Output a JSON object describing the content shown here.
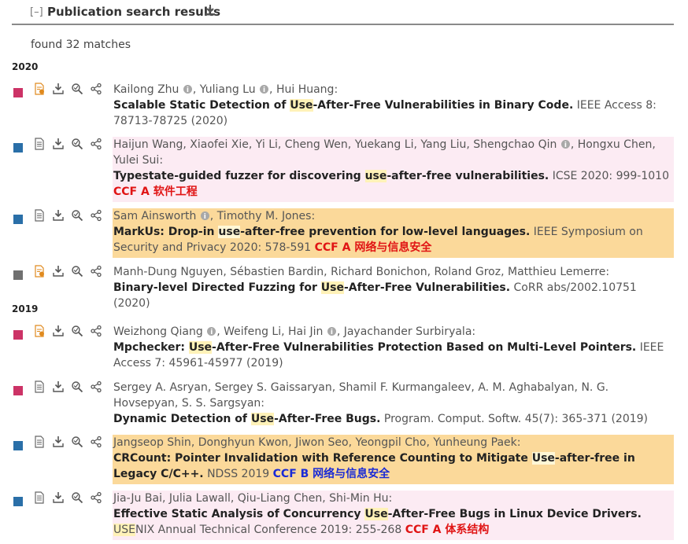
{
  "header": {
    "collapse_label": "[–]",
    "title": "Publication search results"
  },
  "results": {
    "count_text": "found 32 matches"
  },
  "colors": {
    "journal": "#cc3366",
    "conference": "#2a6fa8",
    "informal": "#707070",
    "ccf_a": "#e01414",
    "ccf_b": "#1a2bd6",
    "pink_bg": "#fcebf3",
    "orange_bg": "#fbd99a"
  },
  "years": [
    {
      "year": "2020",
      "entries": [
        {
          "type": "journal",
          "authors": [
            "Kailong Zhu",
            "Yuliang Lu",
            "Hui Huang"
          ],
          "orcid": [
            true,
            true,
            false
          ],
          "title_pre": "Scalable Static Detection of ",
          "title_hl": "Use",
          "title_post": "-After-Free Vulnerabilities in Binary Code.",
          "venue": "IEEE Access 8: 78713-78725 (2020)",
          "ccf": ""
        },
        {
          "type": "conference",
          "authors": [
            "Haijun Wang",
            "Xiaofei Xie",
            "Yi Li",
            "Cheng Wen",
            "Yuekang Li",
            "Yang Liu",
            "Shengchao Qin",
            "Hongxu Chen",
            "Yulei Sui"
          ],
          "orcid": [
            false,
            false,
            false,
            false,
            false,
            false,
            true,
            false,
            false
          ],
          "title_pre": "Typestate-guided fuzzer for discovering ",
          "title_hl": "use",
          "title_post": "-after-free vulnerabilities.",
          "venue": "ICSE 2020: 999-1010",
          "ccf": "CCF A 软件工程"
        },
        {
          "type": "conference",
          "authors": [
            "Sam Ainsworth",
            "Timothy M. Jones"
          ],
          "orcid": [
            true,
            false
          ],
          "title_pre": "MarkUs: Drop-in ",
          "title_hl": "use",
          "title_post": "-after-free prevention for low-level languages.",
          "venue": "IEEE Symposium on Security and Privacy 2020: 578-591",
          "ccf": "CCF A 网络与信息安全"
        },
        {
          "type": "informal",
          "authors": [
            "Manh-Dung Nguyen",
            "Sébastien Bardin",
            "Richard Bonichon",
            "Roland Groz",
            "Matthieu Lemerre"
          ],
          "orcid": [
            false,
            false,
            false,
            false,
            false
          ],
          "title_pre": "Binary-level Directed Fuzzing for ",
          "title_hl": "Use",
          "title_post": "-After-Free Vulnerabilities.",
          "venue": "CoRR abs/2002.10751 (2020)",
          "ccf": ""
        }
      ]
    },
    {
      "year": "2019",
      "entries": [
        {
          "type": "journal",
          "authors": [
            "Weizhong Qiang",
            "Weifeng Li",
            "Hai Jin",
            "Jayachander Surbiryala"
          ],
          "orcid": [
            true,
            false,
            true,
            false
          ],
          "title_pre": "Mpchecker: ",
          "title_hl": "Use",
          "title_post": "-After-Free Vulnerabilities Protection Based on Multi-Level Pointers.",
          "venue": "IEEE Access 7: 45961-45977 (2019)",
          "ccf": ""
        },
        {
          "type": "journal",
          "authors": [
            "Sergey A. Asryan",
            "Sergey S. Gaissaryan",
            "Shamil F. Kurmangaleev",
            "A. M. Aghabalyan",
            "N. G. Hovsepyan",
            "S. S. Sargsyan"
          ],
          "orcid": [
            false,
            false,
            false,
            false,
            false,
            false
          ],
          "title_pre": "Dynamic Detection of ",
          "title_hl": "Use",
          "title_post": "-After-Free Bugs.",
          "venue": "Program. Comput. Softw. 45(7): 365-371 (2019)",
          "ccf": ""
        },
        {
          "type": "conference",
          "authors": [
            "Jangseop Shin",
            "Donghyun Kwon",
            "Jiwon Seo",
            "Yeongpil Cho",
            "Yunheung Paek"
          ],
          "orcid": [
            false,
            false,
            false,
            false,
            false
          ],
          "title_pre": "CRCount: Pointer Invalidation with Reference Counting to Mitigate ",
          "title_hl": "Use",
          "title_post": "-after-free in Legacy C/C++.",
          "venue": "NDSS 2019",
          "ccf": "CCF B 网络与信息安全"
        },
        {
          "type": "conference",
          "authors": [
            "Jia-Ju Bai",
            "Julia Lawall",
            "Qiu-Liang Chen",
            "Shi-Min Hu"
          ],
          "orcid": [
            false,
            false,
            false,
            false
          ],
          "title_pre": "Effective Static Analysis of Concurrency ",
          "title_hl": "Use",
          "title_post": "-After-Free Bugs in Linux Device Drivers.",
          "venue_hl": "USE",
          "venue": "NIX Annual Technical Conference 2019: 255-268",
          "ccf": "CCF A 体系结构"
        }
      ]
    }
  ]
}
